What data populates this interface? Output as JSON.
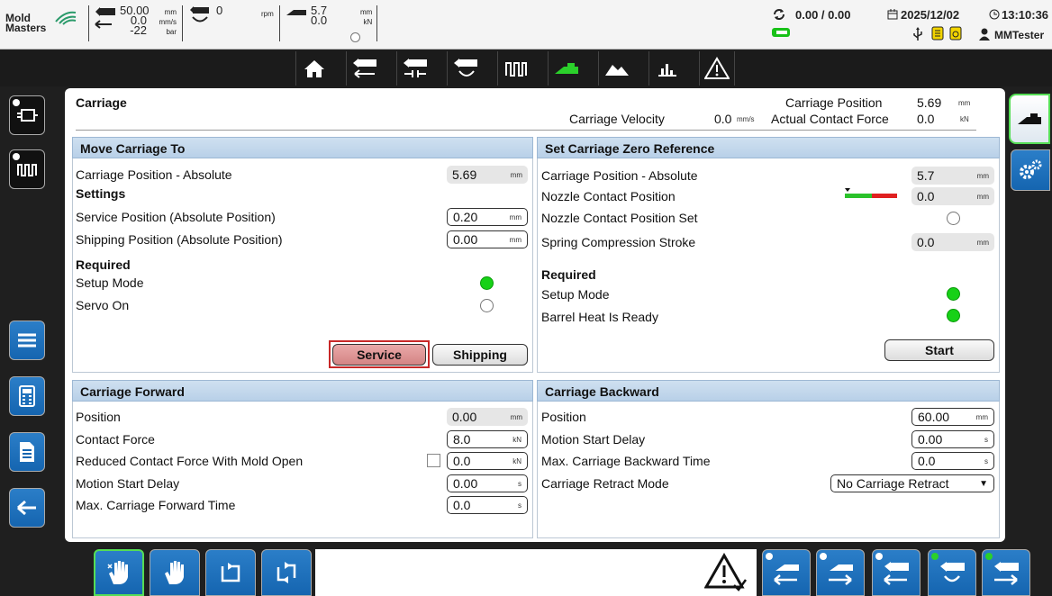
{
  "header": {
    "logo_line1": "Mold",
    "logo_line2": "Masters",
    "injection": {
      "val1": "50.00",
      "val2": "0.0",
      "val3": "-22",
      "unit1": "mm",
      "unit2": "mm/s",
      "unit3": "bar"
    },
    "screw": {
      "val": "0",
      "unit": "rpm"
    },
    "carriage": {
      "val1": "5.7",
      "val2": "0.0",
      "unit1": "mm",
      "unit2": "kN"
    },
    "counter": "0.00 / 0.00",
    "date": "2025/12/02",
    "time": "13:10:36",
    "user": "MMTester"
  },
  "toolbar": {
    "icons": [
      "home-icon",
      "injection-icon",
      "hold-icon",
      "recovery-icon",
      "heats-icon",
      "carriage-icon",
      "mold-icon",
      "chart-icon",
      "alarm-warning-icon"
    ]
  },
  "carriage_header": {
    "title": "Carriage",
    "velocity_label": "Carriage Velocity",
    "velocity_value": "0.0",
    "velocity_unit": "mm/s",
    "position_label": "Carriage Position",
    "position_value": "5.69",
    "position_unit": "mm",
    "force_label": "Actual Contact Force",
    "force_value": "0.0",
    "force_unit": "kN"
  },
  "move_to": {
    "title": "Move Carriage To",
    "pos_abs_label": "Carriage Position - Absolute",
    "pos_abs_value": "5.69",
    "pos_abs_unit": "mm",
    "settings_label": "Settings",
    "service_label": "Service Position (Absolute Position)",
    "service_value": "0.20",
    "service_unit": "mm",
    "shipping_label": "Shipping Position (Absolute Position)",
    "shipping_value": "0.00",
    "shipping_unit": "mm",
    "required_label": "Required",
    "setup_label": "Setup Mode",
    "servo_label": "Servo On",
    "service_button": "Service",
    "shipping_button": "Shipping"
  },
  "zero_ref": {
    "title": "Set Carriage Zero Reference",
    "pos_abs_label": "Carriage Position - Absolute",
    "pos_abs_value": "5.7",
    "pos_abs_unit": "mm",
    "nozzle_label": "Nozzle Contact Position",
    "nozzle_value": "0.0",
    "nozzle_unit": "mm",
    "nozzle_set_label": "Nozzle Contact Position Set",
    "spring_label": "Spring Compression Stroke",
    "spring_value": "0.0",
    "spring_unit": "mm",
    "required_label": "Required",
    "setup_label": "Setup Mode",
    "barrel_label": "Barrel Heat Is Ready",
    "start_button": "Start"
  },
  "forward": {
    "title": "Carriage Forward",
    "position_label": "Position",
    "position_value": "0.00",
    "position_unit": "mm",
    "force_label": "Contact Force",
    "force_value": "8.0",
    "force_unit": "kN",
    "reduced_label": "Reduced Contact Force With Mold Open",
    "reduced_value": "0.0",
    "reduced_unit": "kN",
    "delay_label": "Motion Start Delay",
    "delay_value": "0.00",
    "delay_unit": "s",
    "maxtime_label": "Max. Carriage Forward Time",
    "maxtime_value": "0.0",
    "maxtime_unit": "s"
  },
  "backward": {
    "title": "Carriage Backward",
    "position_label": "Position",
    "position_value": "60.00",
    "position_unit": "mm",
    "delay_label": "Motion Start Delay",
    "delay_value": "0.00",
    "delay_unit": "s",
    "maxtime_label": "Max. Carriage Backward Time",
    "maxtime_value": "0.0",
    "maxtime_unit": "s",
    "retract_label": "Carriage Retract Mode",
    "retract_value": "No Carriage Retract"
  },
  "colors": {
    "accent_blue": "#1565b0",
    "led_green": "#17d117",
    "service_red": "#c82828"
  }
}
